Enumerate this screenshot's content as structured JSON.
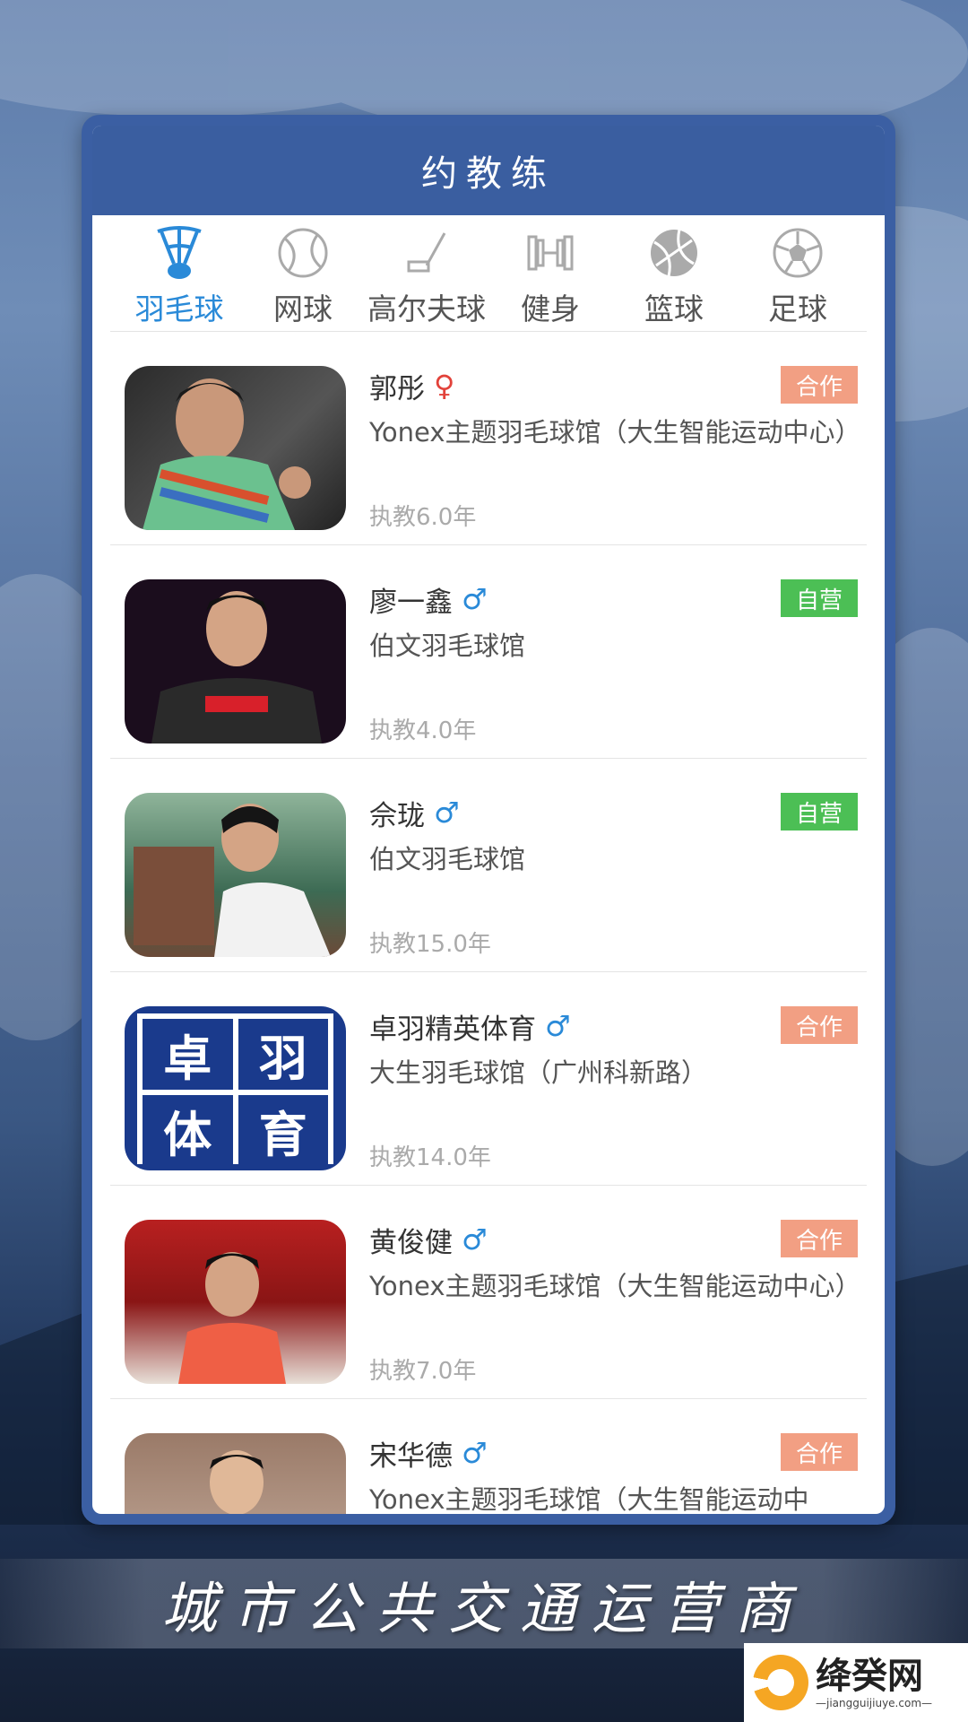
{
  "header": {
    "title": "约教练"
  },
  "tabs": [
    {
      "label": "羽毛球",
      "icon": "shuttlecock-icon",
      "active": true
    },
    {
      "label": "网球",
      "icon": "tennis-ball-icon",
      "active": false
    },
    {
      "label": "高尔夫球",
      "icon": "golf-club-icon",
      "active": false
    },
    {
      "label": "健身",
      "icon": "dumbbell-icon",
      "active": false
    },
    {
      "label": "篮球",
      "icon": "basketball-icon",
      "active": false
    },
    {
      "label": "足球",
      "icon": "soccer-ball-icon",
      "active": false
    }
  ],
  "coaches": [
    {
      "name": "郭彤",
      "gender": "♀",
      "venue": "Yonex主题羽毛球馆（大生智能运动中心）",
      "years": "执教6.0年",
      "badge": "合作",
      "badge_type": "coop"
    },
    {
      "name": "廖一鑫",
      "gender": "♂",
      "venue": "伯文羽毛球馆",
      "years": "执教4.0年",
      "badge": "自营",
      "badge_type": "self"
    },
    {
      "name": "佘珑",
      "gender": "♂",
      "venue": "伯文羽毛球馆",
      "years": "执教15.0年",
      "badge": "自营",
      "badge_type": "self"
    },
    {
      "name": "卓羽精英体育",
      "gender": "♂",
      "venue": "大生羽毛球馆（广州科新路）",
      "years": "执教14.0年",
      "badge": "合作",
      "badge_type": "coop",
      "logo_text": [
        "卓",
        "羽",
        "体",
        "育"
      ]
    },
    {
      "name": "黄俊健",
      "gender": "♂",
      "venue": "Yonex主题羽毛球馆（大生智能运动中心）",
      "years": "执教7.0年",
      "badge": "合作",
      "badge_type": "coop"
    },
    {
      "name": "宋华德",
      "gender": "♂",
      "venue": "Yonex主题羽毛球馆（大生智能运动中",
      "years": "",
      "badge": "合作",
      "badge_type": "coop"
    }
  ],
  "banner": {
    "text": "城市公共交通运营商"
  },
  "watermark": {
    "name": "绛癸网",
    "url": "—jiangguijiuye.com—"
  },
  "colors": {
    "header": "#3a5ea0",
    "active_tab": "#2a8ad8",
    "coop_badge": "#f29f83",
    "self_badge": "#4cbf55"
  }
}
